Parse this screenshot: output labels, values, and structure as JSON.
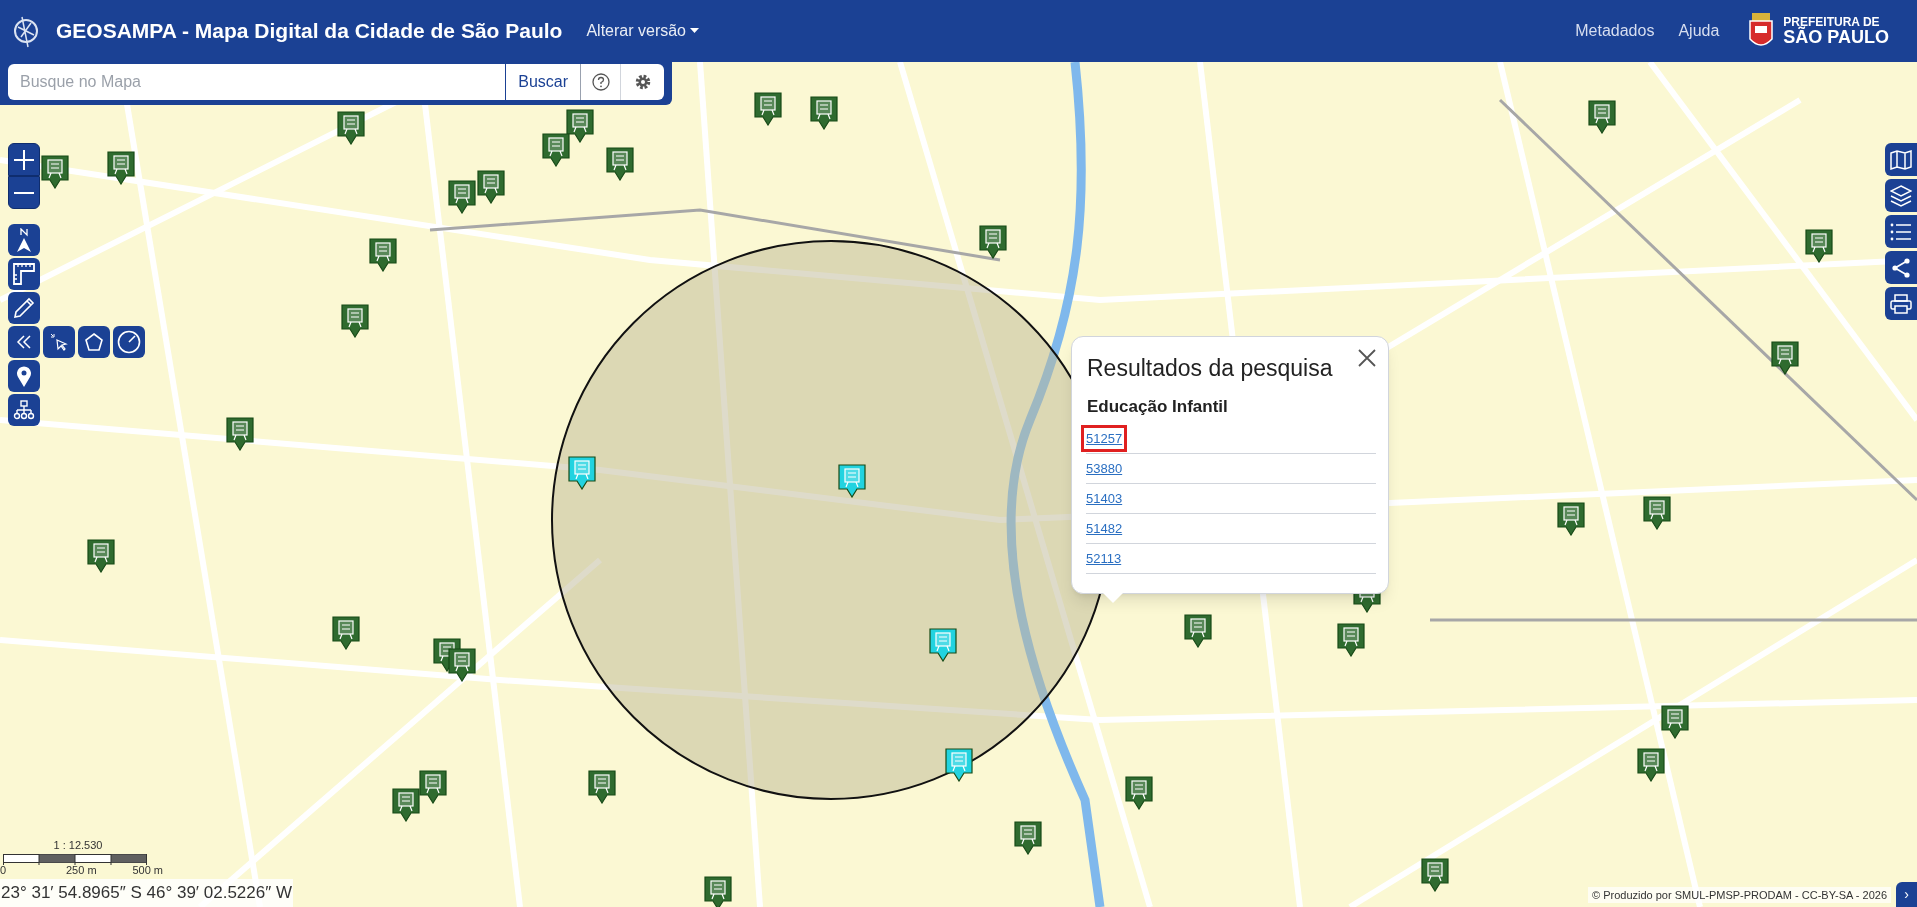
{
  "header": {
    "title": "GEOSAMPA - Mapa Digital da Cidade de São Paulo",
    "version_menu": "Alterar versão",
    "links": [
      "Metadados",
      "Ajuda"
    ],
    "logo_text": [
      "PREFEITURA DE",
      "SÃO PAULO"
    ]
  },
  "search": {
    "placeholder": "Busque no Mapa",
    "button": "Buscar"
  },
  "map": {
    "markers": [
      {
        "highlighted": false
      },
      {
        "highlighted": false
      },
      {
        "highlighted": false
      },
      {
        "highlighted": false
      },
      {
        "highlighted": false
      },
      {
        "highlighted": false
      },
      {
        "highlighted": false
      },
      {
        "highlighted": false
      },
      {
        "highlighted": false
      },
      {
        "highlighted": false
      },
      {
        "highlighted": false
      },
      {
        "highlighted": false
      },
      {
        "highlighted": false
      },
      {
        "highlighted": false
      },
      {
        "highlighted": false
      },
      {
        "highlighted": false
      },
      {
        "highlighted": false
      },
      {
        "highlighted": false
      },
      {
        "highlighted": false
      },
      {
        "highlighted": false
      },
      {
        "highlighted": false
      },
      {
        "highlighted": false
      },
      {
        "highlighted": false
      },
      {
        "highlighted": false
      },
      {
        "highlighted": false
      },
      {
        "highlighted": false
      },
      {
        "highlighted": false
      },
      {
        "highlighted": false
      },
      {
        "highlighted": false
      },
      {
        "highlighted": false
      },
      {
        "highlighted": false
      },
      {
        "highlighted": false
      },
      {
        "highlighted": false
      },
      {
        "highlighted": false
      },
      {
        "highlighted": false
      },
      {
        "highlighted": true
      },
      {
        "highlighted": true
      },
      {
        "highlighted": true
      },
      {
        "highlighted": true
      }
    ]
  },
  "popup": {
    "title": "Resultados da pesquisa",
    "category": "Educação Infantil",
    "results": [
      {
        "label": "51257",
        "selected": true
      },
      {
        "label": "53880",
        "selected": false
      },
      {
        "label": "51403",
        "selected": false
      },
      {
        "label": "51482",
        "selected": false
      },
      {
        "label": "52113",
        "selected": false
      }
    ]
  },
  "scale": {
    "ratio": "1 : 12.530",
    "ticks": [
      "0",
      "250 m",
      "500 m"
    ]
  },
  "coordinates": "23° 31′ 54.8965″ S 46° 39′ 02.5226″ W",
  "attribution": "© Produzido por SMUL-PMSP-PRODAM - CC-BY-SA - 2026",
  "expand_button": "›"
}
